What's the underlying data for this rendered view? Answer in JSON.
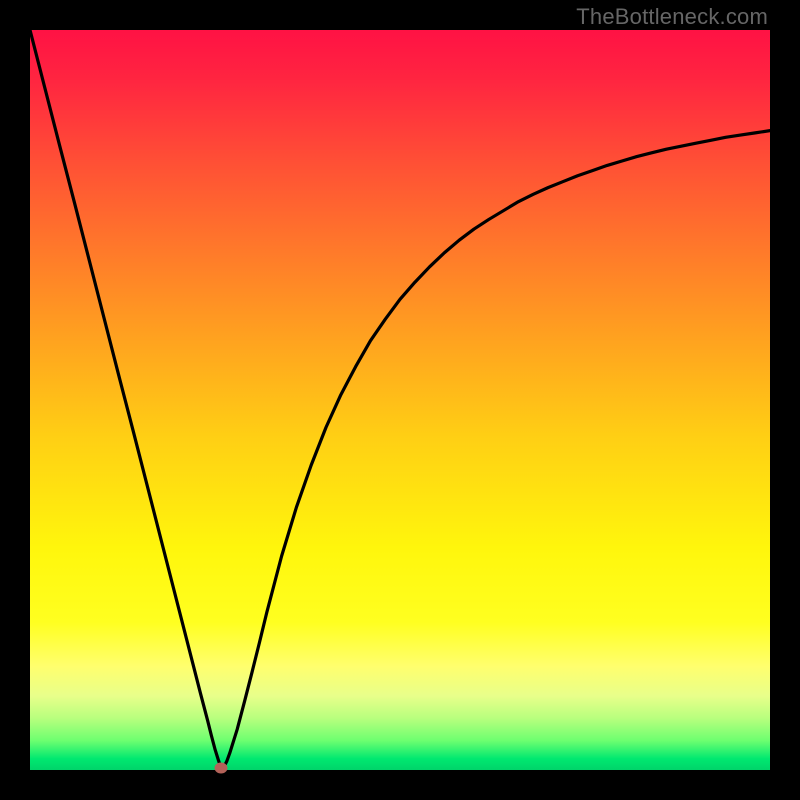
{
  "watermark": "TheBottleneck.com",
  "chart_data": {
    "type": "line",
    "title": "",
    "xlabel": "",
    "ylabel": "",
    "xlim": [
      0,
      1
    ],
    "ylim": [
      0,
      1
    ],
    "series": [
      {
        "name": "curve",
        "x": [
          0.0,
          0.02,
          0.04,
          0.06,
          0.08,
          0.1,
          0.12,
          0.14,
          0.16,
          0.18,
          0.2,
          0.21,
          0.22,
          0.23,
          0.24,
          0.245,
          0.25,
          0.255,
          0.258,
          0.262,
          0.266,
          0.27,
          0.28,
          0.29,
          0.3,
          0.31,
          0.32,
          0.34,
          0.36,
          0.38,
          0.4,
          0.42,
          0.44,
          0.46,
          0.48,
          0.5,
          0.52,
          0.54,
          0.56,
          0.58,
          0.6,
          0.62,
          0.64,
          0.66,
          0.68,
          0.7,
          0.72,
          0.74,
          0.76,
          0.78,
          0.8,
          0.82,
          0.84,
          0.86,
          0.88,
          0.9,
          0.92,
          0.94,
          0.96,
          0.98,
          1.0
        ],
        "y": [
          1.0,
          0.922,
          0.844,
          0.767,
          0.689,
          0.611,
          0.533,
          0.456,
          0.378,
          0.3,
          0.222,
          0.183,
          0.144,
          0.105,
          0.067,
          0.047,
          0.028,
          0.012,
          0.004,
          0.004,
          0.012,
          0.023,
          0.055,
          0.093,
          0.132,
          0.172,
          0.213,
          0.289,
          0.355,
          0.412,
          0.463,
          0.507,
          0.545,
          0.58,
          0.609,
          0.636,
          0.659,
          0.68,
          0.699,
          0.716,
          0.731,
          0.744,
          0.756,
          0.768,
          0.778,
          0.787,
          0.795,
          0.803,
          0.81,
          0.817,
          0.823,
          0.829,
          0.834,
          0.839,
          0.843,
          0.847,
          0.851,
          0.855,
          0.858,
          0.861,
          0.864
        ]
      }
    ],
    "marker": {
      "x": 0.258,
      "y": 0.003
    },
    "gradient_stops": [
      {
        "offset": 0.0,
        "color": "#ff1244"
      },
      {
        "offset": 0.07,
        "color": "#ff2640"
      },
      {
        "offset": 0.18,
        "color": "#ff5035"
      },
      {
        "offset": 0.3,
        "color": "#ff7a2a"
      },
      {
        "offset": 0.42,
        "color": "#ffa31f"
      },
      {
        "offset": 0.55,
        "color": "#ffcf14"
      },
      {
        "offset": 0.7,
        "color": "#fff60c"
      },
      {
        "offset": 0.8,
        "color": "#ffff20"
      },
      {
        "offset": 0.86,
        "color": "#ffff6e"
      },
      {
        "offset": 0.9,
        "color": "#e8ff8a"
      },
      {
        "offset": 0.93,
        "color": "#b8ff7e"
      },
      {
        "offset": 0.96,
        "color": "#6eff70"
      },
      {
        "offset": 0.985,
        "color": "#00e870"
      },
      {
        "offset": 1.0,
        "color": "#00d46a"
      }
    ]
  }
}
